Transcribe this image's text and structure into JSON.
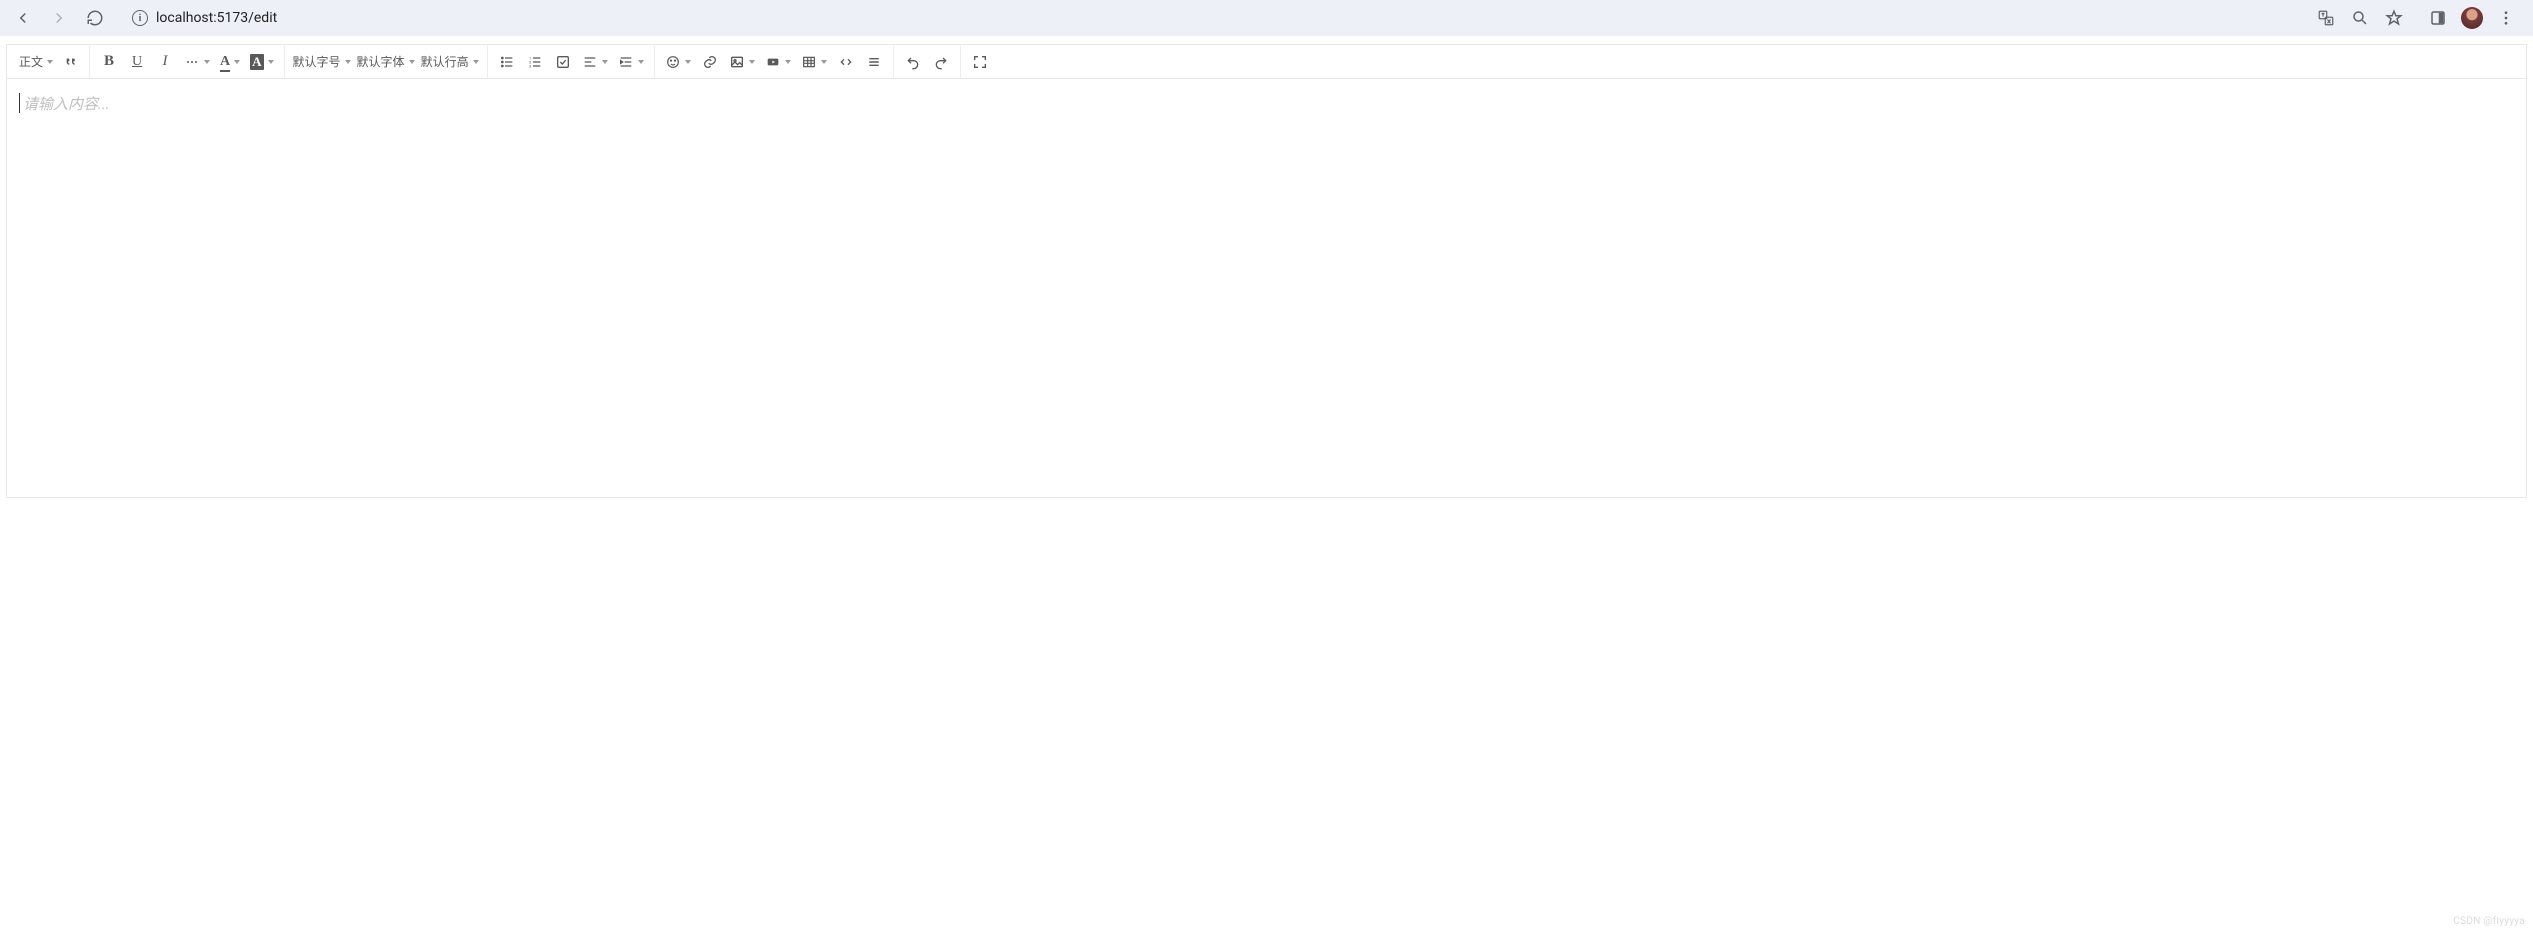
{
  "browser": {
    "url": "localhost:5173/edit",
    "icons": {
      "back": "back-icon",
      "forward": "forward-icon",
      "reload": "reload-icon",
      "info": "info-icon",
      "translate": "translate-icon",
      "zoom": "zoom-icon",
      "bookmark": "bookmark-icon",
      "sidepanel": "sidepanel-icon",
      "profile": "profile-avatar",
      "menu": "menu-icon"
    }
  },
  "toolbar": {
    "heading_label": "正文",
    "font_size_label": "默认字号",
    "font_family_label": "默认字体",
    "line_height_label": "默认行高",
    "icons": {
      "blockquote": "blockquote-icon",
      "bold": "B",
      "underline": "U",
      "italic": "I",
      "more": "more-icon",
      "text_color": "A",
      "bg_color": "A",
      "ul": "unordered-list-icon",
      "ol": "ordered-list-icon",
      "todo": "todo-icon",
      "align": "align-icon",
      "indent": "indent-icon",
      "emoji": "emoji-icon",
      "link": "link-icon",
      "image": "image-icon",
      "video": "video-icon",
      "table": "table-icon",
      "code": "code-icon",
      "divider": "divider-icon",
      "undo": "undo-icon",
      "redo": "redo-icon",
      "fullscreen": "fullscreen-icon"
    }
  },
  "editor": {
    "placeholder": "请输入内容..."
  },
  "watermark": "CSDN @flyyyya"
}
